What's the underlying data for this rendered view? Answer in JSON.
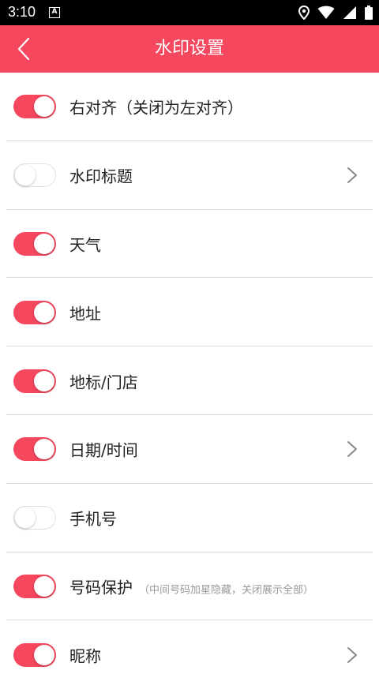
{
  "status_bar": {
    "time": "3:10",
    "notification_letter": "A",
    "icons": [
      "location-icon",
      "wifi-icon",
      "signal-icon",
      "battery-icon"
    ]
  },
  "app_bar": {
    "title": "水印设置",
    "color": "#f5485f"
  },
  "settings": [
    {
      "label": "右对齐（关闭为左对齐）",
      "hint": "",
      "enabled": true,
      "has_chevron": false
    },
    {
      "label": "水印标题",
      "hint": "",
      "enabled": false,
      "has_chevron": true
    },
    {
      "label": "天气",
      "hint": "",
      "enabled": true,
      "has_chevron": false
    },
    {
      "label": "地址",
      "hint": "",
      "enabled": true,
      "has_chevron": false
    },
    {
      "label": "地标/门店",
      "hint": "",
      "enabled": true,
      "has_chevron": false
    },
    {
      "label": "日期/时间",
      "hint": "",
      "enabled": true,
      "has_chevron": true
    },
    {
      "label": "手机号",
      "hint": "",
      "enabled": false,
      "has_chevron": false
    },
    {
      "label": "号码保护",
      "hint": "（中间号码加星隐藏，关闭展示全部）",
      "enabled": true,
      "has_chevron": false
    },
    {
      "label": "昵称",
      "hint": "",
      "enabled": true,
      "has_chevron": true
    }
  ]
}
